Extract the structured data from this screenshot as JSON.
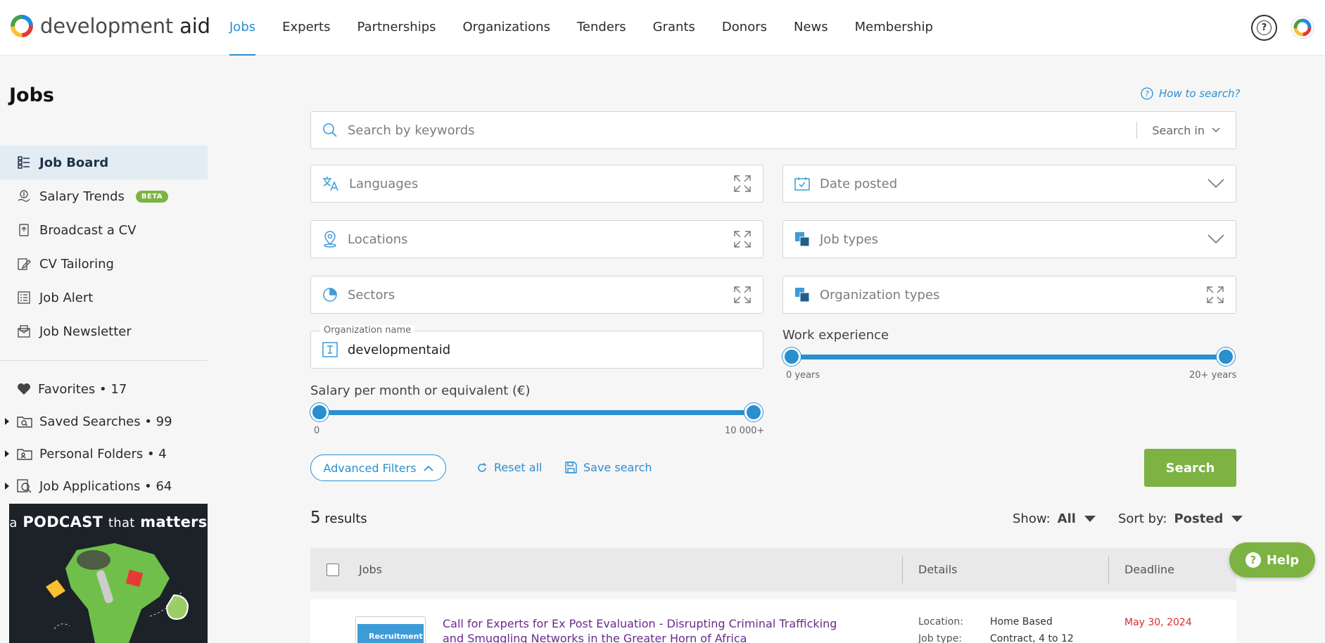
{
  "brand": {
    "name_light": "development",
    "name_bold": "aid",
    "accent": "#2a8fcf",
    "green": "#7cb342"
  },
  "nav": [
    {
      "label": "Jobs",
      "active": true
    },
    {
      "label": "Experts"
    },
    {
      "label": "Partnerships"
    },
    {
      "label": "Organizations"
    },
    {
      "label": "Tenders"
    },
    {
      "label": "Grants"
    },
    {
      "label": "Donors"
    },
    {
      "label": "News"
    },
    {
      "label": "Membership"
    }
  ],
  "sidebar": {
    "title": "Jobs",
    "items": [
      {
        "label": "Job Board",
        "icon": "job-board-icon",
        "active": true
      },
      {
        "label": "Salary Trends",
        "icon": "salary-icon",
        "badge": "BETA"
      },
      {
        "label": "Broadcast a CV",
        "icon": "broadcast-icon"
      },
      {
        "label": "CV Tailoring",
        "icon": "edit-icon"
      },
      {
        "label": "Job Alert",
        "icon": "list-icon"
      },
      {
        "label": "Job Newsletter",
        "icon": "newsletter-icon"
      }
    ],
    "personal": [
      {
        "label": "Favorites • 17",
        "icon": "heart-icon"
      },
      {
        "label": "Saved Searches • 99",
        "icon": "saved-search-folder-icon"
      },
      {
        "label": "Personal Folders • 4",
        "icon": "personal-folder-icon"
      },
      {
        "label": "Job Applications • 64",
        "icon": "applications-icon"
      }
    ],
    "podcast": {
      "text_a": "a",
      "text_b": "PODCAST",
      "text_c": "that",
      "text_d": "matters"
    }
  },
  "search": {
    "how_to": "How to search?",
    "keywords_placeholder": "Search by keywords",
    "search_in": "Search in",
    "languages": "Languages",
    "date_posted": "Date posted",
    "locations": "Locations",
    "job_types": "Job types",
    "sectors": "Sectors",
    "org_types": "Organization types",
    "org_name_label": "Organization name",
    "org_name_value": "developmentaid",
    "work_exp_label": "Work experience",
    "work_exp_min": "0 years",
    "work_exp_max": "20+ years",
    "salary_label": "Salary per month or equivalent (€)",
    "salary_min": "0",
    "salary_max": "10 000+",
    "advanced": "Advanced Filters",
    "reset": "Reset all",
    "save": "Save search",
    "submit": "Search"
  },
  "results": {
    "count": "5",
    "label": "results",
    "show_label": "Show:",
    "show_value": "All",
    "sort_label": "Sort by:",
    "sort_value": "Posted",
    "columns": {
      "jobs": "Jobs",
      "details": "Details",
      "deadline": "Deadline"
    },
    "rows": [
      {
        "title": "Call for Experts for Ex Post Evaluation - Disrupting Criminal Trafficking and Smuggling Networks in the Greater Horn of Africa",
        "thumb": "Recruitment",
        "location_k": "Location:",
        "location_v": "Home Based",
        "type_k": "Job type:",
        "type_v": "Contract, 4 to 12",
        "deadline": "May 30, 2024"
      }
    ]
  },
  "help": "Help"
}
